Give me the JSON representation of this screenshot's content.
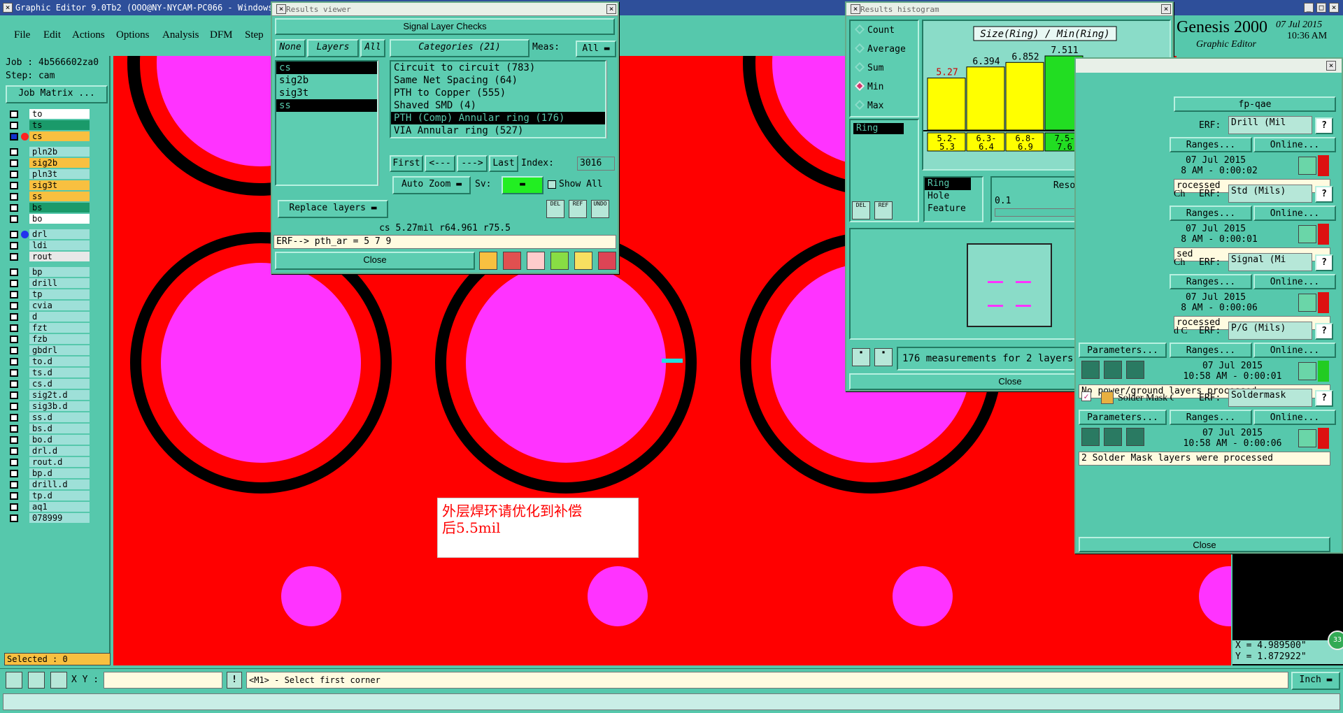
{
  "title_bar": "Graphic Editor 9.0Tb2 (OOO@NY-NYCAM-PC066 - Windows,",
  "menu": [
    "File",
    "Edit",
    "Actions",
    "Options",
    "Analysis",
    "DFM",
    "Step"
  ],
  "job": {
    "job_label": "Job : 4b566602za0",
    "step_label": "Step: cam",
    "matrix_button": "Job Matrix ..."
  },
  "layers": [
    {
      "name": "to",
      "bg": "#ffffff"
    },
    {
      "name": "ts",
      "bg": "#1a9a6a"
    },
    {
      "name": "cs",
      "bg": "#f8c040"
    },
    {
      "name": "pln2b",
      "bg": "#9ee0d8"
    },
    {
      "name": "sig2b",
      "bg": "#f8c040"
    },
    {
      "name": "pln3t",
      "bg": "#9ee0d8"
    },
    {
      "name": "sig3t",
      "bg": "#f8c040"
    },
    {
      "name": "ss",
      "bg": "#f8c040"
    },
    {
      "name": "bs",
      "bg": "#1a9a6a"
    },
    {
      "name": "bo",
      "bg": "#ffffff"
    },
    {
      "name": "drl",
      "bg": "#9ee0d8"
    },
    {
      "name": "ldi",
      "bg": "#9ee0d8"
    },
    {
      "name": "rout",
      "bg": "#e8e8e8"
    },
    {
      "name": "bp",
      "bg": "#9ee0d8"
    },
    {
      "name": "drill",
      "bg": "#9ee0d8"
    },
    {
      "name": "tp",
      "bg": "#9ee0d8"
    },
    {
      "name": "cvia",
      "bg": "#9ee0d8"
    },
    {
      "name": "d",
      "bg": "#9ee0d8"
    },
    {
      "name": "fzt",
      "bg": "#9ee0d8"
    },
    {
      "name": "fzb",
      "bg": "#9ee0d8"
    },
    {
      "name": "gbdrl",
      "bg": "#9ee0d8"
    },
    {
      "name": "to.d",
      "bg": "#9ee0d8"
    },
    {
      "name": "ts.d",
      "bg": "#9ee0d8"
    },
    {
      "name": "cs.d",
      "bg": "#9ee0d8"
    },
    {
      "name": "sig2t.d",
      "bg": "#9ee0d8"
    },
    {
      "name": "sig3b.d",
      "bg": "#9ee0d8"
    },
    {
      "name": "ss.d",
      "bg": "#9ee0d8"
    },
    {
      "name": "bs.d",
      "bg": "#9ee0d8"
    },
    {
      "name": "bo.d",
      "bg": "#9ee0d8"
    },
    {
      "name": "drl.d",
      "bg": "#9ee0d8"
    },
    {
      "name": "rout.d",
      "bg": "#9ee0d8"
    },
    {
      "name": "bp.d",
      "bg": "#9ee0d8"
    },
    {
      "name": "drill.d",
      "bg": "#9ee0d8"
    },
    {
      "name": "tp.d",
      "bg": "#9ee0d8"
    },
    {
      "name": "aq1",
      "bg": "#9ee0d8"
    },
    {
      "name": "078999",
      "bg": "#9ee0d8"
    }
  ],
  "selected_label": "Selected : 0",
  "annotation": {
    "line1": "外层焊环请优化到补偿",
    "line2": "后5.5mil"
  },
  "results_viewer": {
    "title": "Results viewer",
    "header": "Signal Layer Checks",
    "btn_none": "None",
    "btn_layers": "Layers",
    "btn_all": "All",
    "categories_label": "Categories (21)",
    "meas_label": "Meas:",
    "meas_value": "All",
    "layer_list": [
      "cs",
      "sig2b",
      "sig3t",
      "ss"
    ],
    "category_list": [
      "Circuit to circuit (783)",
      "Same Net Spacing (64)",
      "PTH to Copper (555)",
      "Shaved SMD (4)",
      "PTH (Comp) Annular ring (176)",
      "VIA Annular ring (527)"
    ],
    "nav_first": "First",
    "nav_prev": "<---",
    "nav_next": "--->",
    "nav_last": "Last",
    "index_label": "Index:",
    "index_value": "3016",
    "auto_zoom": "Auto Zoom",
    "sv_label": "Sv:",
    "show_all": "Show All",
    "replace_layers": "Replace layers",
    "status": "cs 5.27mil  r64.961  r75.5",
    "erf": "ERF--> pth_ar = 5 7 9",
    "close": "Close",
    "del": "DEL",
    "ref": "REF",
    "undo": "UNDO"
  },
  "histogram": {
    "title": "Results histogram",
    "modes": [
      "Count",
      "Average",
      "Sum",
      "Min",
      "Max"
    ],
    "selected_mode": "Min",
    "chart_title": "Size(Ring) / Min(Ring)",
    "ring_list": [
      "Ring"
    ],
    "attr_list": [
      "Ring",
      "Hole",
      "Feature"
    ],
    "resolution_label": "Resolution",
    "resolution_value": "0.1",
    "measurements": "176 measurements for 2 layers",
    "close": "Close",
    "del": "DEL",
    "ref": "REF"
  },
  "chart_data": {
    "type": "bar",
    "title": "Size(Ring) / Min(Ring)",
    "categories": [
      "5.2-5.3",
      "6.3-6.4",
      "6.8-6.9",
      "7.5-7.6"
    ],
    "values": [
      5.27,
      6.394,
      6.852,
      7.511
    ],
    "colors": [
      "#ffff00",
      "#ffff00",
      "#ffff00",
      "#22dd22"
    ]
  },
  "genesis": {
    "brand": "Genesis 2000",
    "subtitle": "Graphic Editor",
    "date": "07 Jul 2015",
    "time": "10:36 AM"
  },
  "checklist": {
    "header": "fp-qae",
    "erf_label": "ERF:",
    "params_label": "Parameters...",
    "ranges_label": "Ranges...",
    "online_label": "Online...",
    "items": [
      {
        "erf": "Drill (Mil",
        "date": "07 Jul 2015",
        "time": "8 AM - 0:00:02",
        "status": "rocessed"
      },
      {
        "name": "Ch",
        "erf": "Std (Mils)",
        "date": "07 Jul 2015",
        "time": "8 AM - 0:00:01",
        "status": "sed"
      },
      {
        "name": "Ch",
        "erf": "Signal (Mi",
        "date": "07 Jul 2015",
        "time": "8 AM - 0:00:06",
        "status": "rocessed"
      },
      {
        "name": "d C",
        "erf": "P/G (Mils)",
        "date": "07 Jul 2015",
        "time": "10:58 AM - 0:00:01",
        "status": "No power/ground layers processed"
      },
      {
        "name": "Solder Mask Ch",
        "erf": "Soldermask",
        "date": "07 Jul 2015",
        "time": "10:58 AM - 0:00:06",
        "status": "2 Solder Mask layers were processed"
      }
    ],
    "close": "Close"
  },
  "coords": {
    "x": "X = 4.989500\"",
    "y": "Y = 1.872922\""
  },
  "bottom": {
    "xy_label": "X Y :",
    "hint": "<M1> - Select first corner",
    "units": "Inch",
    "badge": "33"
  }
}
